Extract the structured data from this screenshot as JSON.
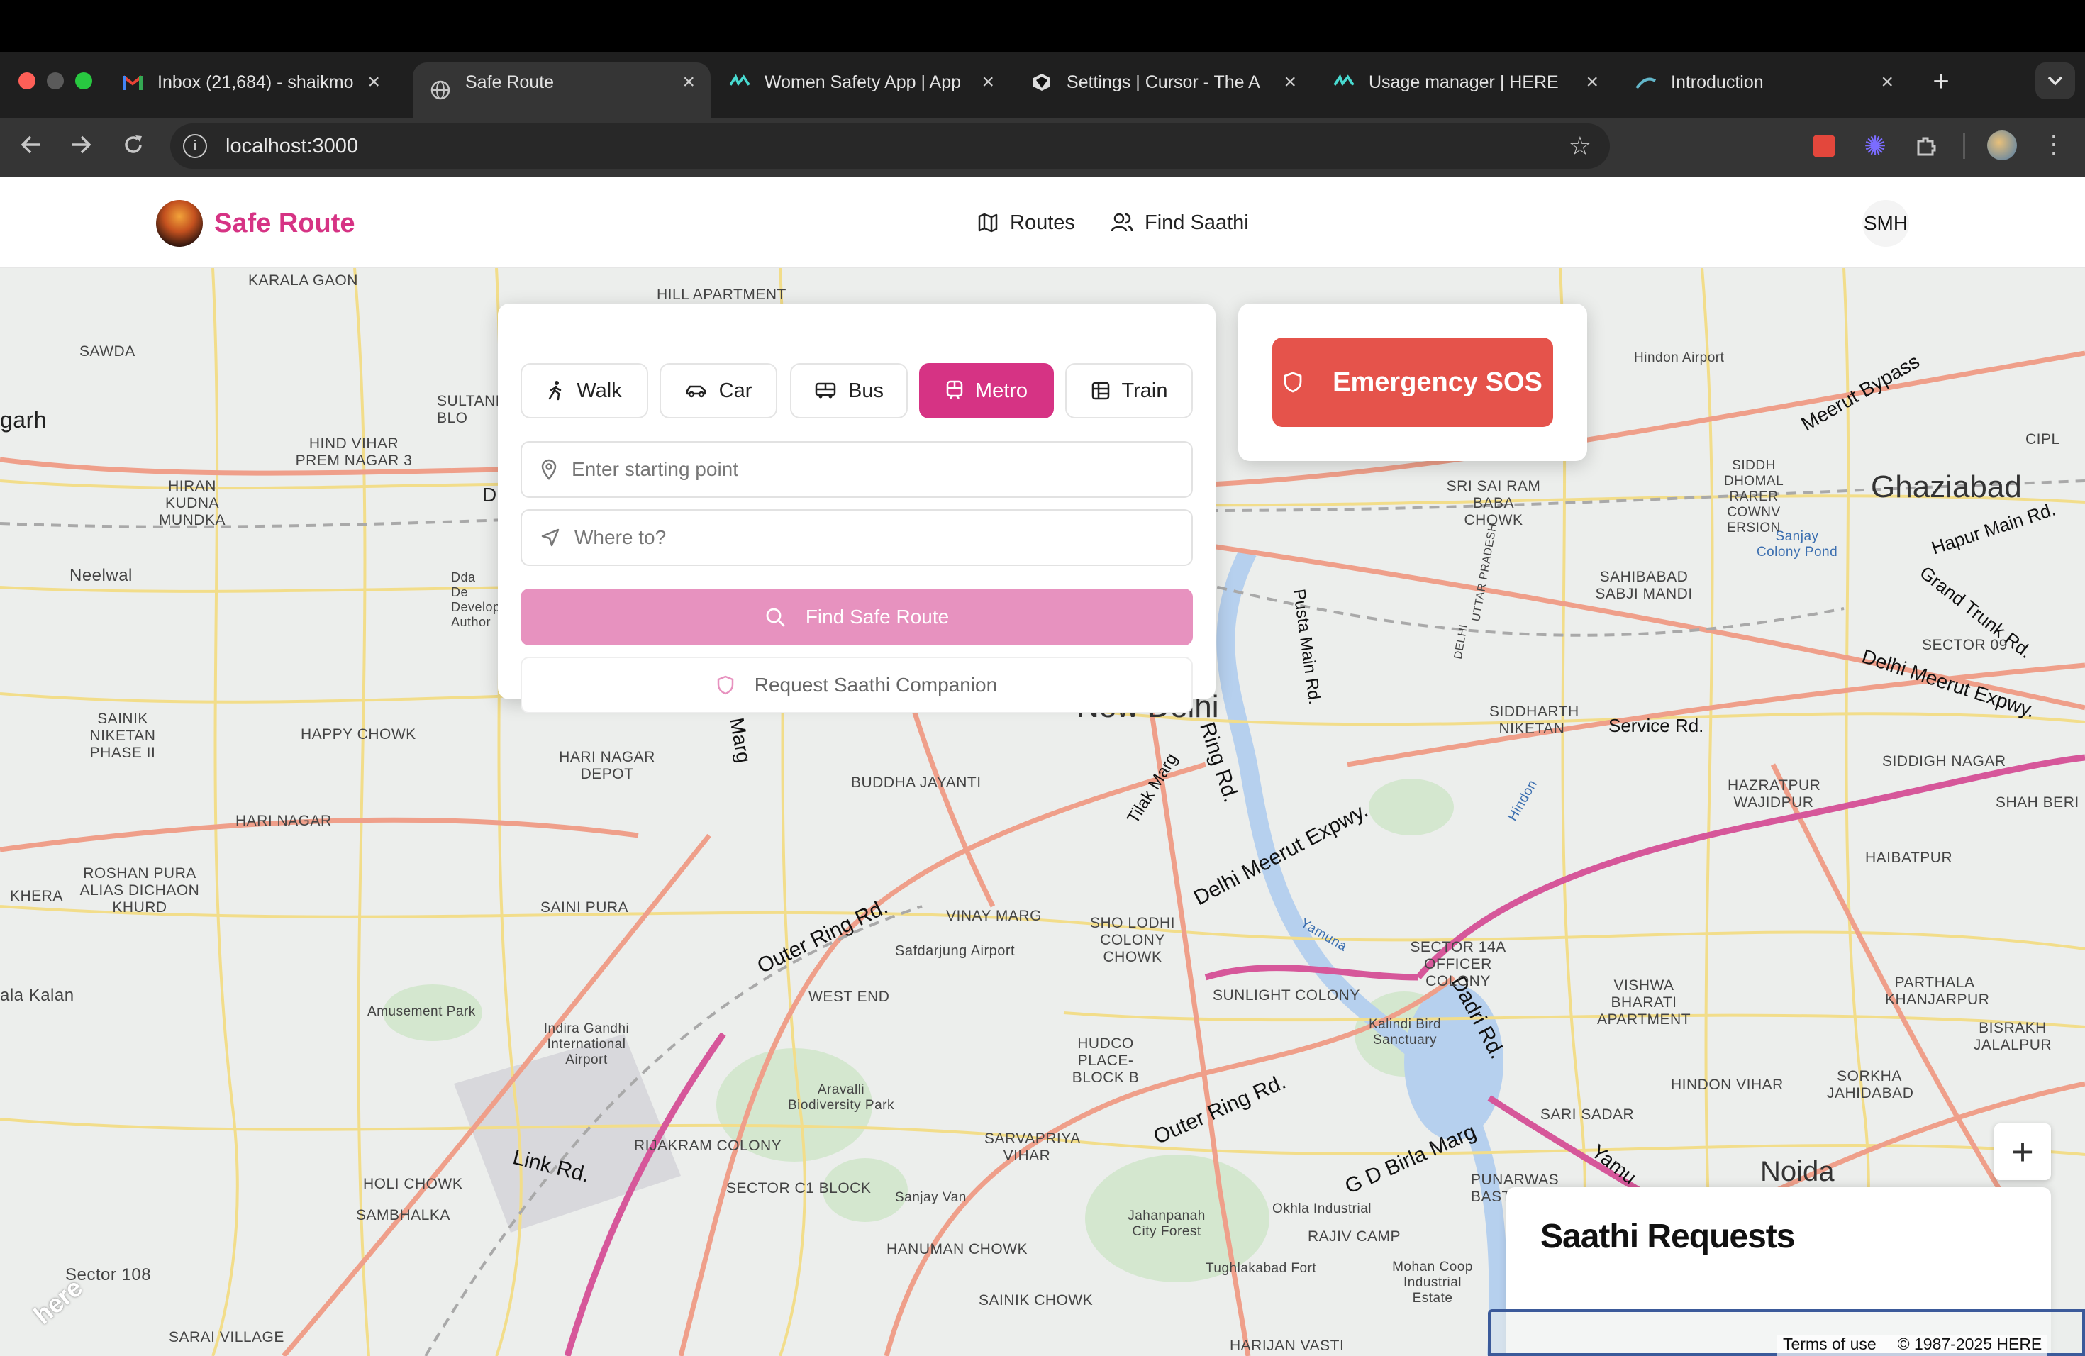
{
  "browser": {
    "tabs": [
      {
        "title": "Inbox (21,684) - shaikmo",
        "icon": "gmail-icon",
        "active": false
      },
      {
        "title": "Safe Route",
        "icon": "globe-icon",
        "active": true
      },
      {
        "title": "Women Safety App | App",
        "icon": "here-icon",
        "active": false
      },
      {
        "title": "Settings | Cursor - The A",
        "icon": "cursor-icon",
        "active": false
      },
      {
        "title": "Usage manager | HERE",
        "icon": "here-icon",
        "active": false
      },
      {
        "title": "Introduction",
        "icon": "docs-icon",
        "active": false
      }
    ],
    "url": "localhost:3000",
    "new_tab_label": "+",
    "close_label": "×"
  },
  "app": {
    "brand": "Safe Route",
    "brand_color": "#d63384",
    "nav": [
      {
        "label": "Routes",
        "icon": "map-icon"
      },
      {
        "label": "Find Saathi",
        "icon": "users-icon"
      }
    ],
    "user_initials": "SMH"
  },
  "route_panel": {
    "modes": [
      {
        "label": "Walk",
        "icon": "walk-icon",
        "selected": false
      },
      {
        "label": "Car",
        "icon": "car-icon",
        "selected": false
      },
      {
        "label": "Bus",
        "icon": "bus-icon",
        "selected": false
      },
      {
        "label": "Metro",
        "icon": "metro-icon",
        "selected": true
      },
      {
        "label": "Train",
        "icon": "train-icon",
        "selected": false
      }
    ],
    "start_placeholder": "Enter starting point",
    "destination_placeholder": "Where to?",
    "find_button": "Find Safe Route",
    "companion_button": "Request Saathi Companion"
  },
  "sos": {
    "label": "Emergency SOS",
    "color": "#e5534b"
  },
  "saathi_panel": {
    "title": "Saathi Requests"
  },
  "map": {
    "zoom_in_label": "+",
    "terms": "Terms of use",
    "copyright": "© 1987-2025 HERE",
    "watermark": "here",
    "cities": [
      "New Delhi",
      "Ghaziabad",
      "Noida"
    ],
    "roads": [
      "Outer Ring Rd.",
      "Delhi Meerut Expwy.",
      "Ring Rd.",
      "Outer Ring Rd.",
      "Link Rd.",
      "Dadri Rd.",
      "G D Birla Marg",
      "Tilak Marg",
      "Meerut Bypass",
      "Hapur Main Rd.",
      "Grand Trunk Rd.",
      "Delhi Meerut Expwy.",
      "Service Rd.",
      "Pusta Main Rd.",
      "ndhi Marg",
      "Yamu"
    ],
    "places": [
      "KARALA GAON",
      "SAWDA",
      "HILL APARTMENT",
      "HIND VIHAR PREM NAGAR 3",
      "HIRAN KUDNA MUNDKA",
      "Neelwal",
      "SULTANP BLO",
      "Dda De Develop Author",
      "SAINIK NIKETAN PHASE II",
      "HAPPY CHOWK",
      "HARI NAGAR DEPOT",
      "BUDDHA JAYANTI",
      "HARI NAGAR",
      "ROSHAN PURA ALIAS DICHAON KHURD",
      "KHERA",
      "SAINI PURA",
      "VINAY MARG",
      "SHO LODHI COLONY CHOWK",
      "Safdarjung Airport",
      "WEST END",
      "SUNLIGHT COLONY",
      "Amusement Park",
      "Indira Gandhi International Airport",
      "HUDCO PLACE-BLOCK B",
      "Aravalli Biodiversity Park",
      "RIJAKRAM COLONY",
      "SARVAPRIYA VIHAR",
      "SECTOR C1 BLOCK",
      "HOLI CHOWK",
      "SAMBHALKA",
      "Sanjay Van",
      "HANUMAN CHOWK",
      "Sector 108",
      "SARAI VILLAGE",
      "SAINIK CHOWK",
      "HARIJAN VASTI",
      "Tughlakabad Fort",
      "Jahanpanah City Forest",
      "Okhla Industrial",
      "RAJIV CAMP",
      "Mohan Coop Industrial Estate",
      "PUNARWAS BASTI PHASE III",
      "SARI SADAR",
      "Kalindi Bird Sanctuary",
      "SECTOR 14A OFFICER COLONY",
      "VISHWA BHARATI APARTMENT",
      "HINDON VIHAR",
      "SORKHA JAHIDABAD",
      "BISRAKH JALALPUR",
      "PARTHALA KHANJARPUR",
      "HAIBATPUR",
      "SHAH BERI",
      "SIDDIGH NAGAR",
      "HAZRATPUR WAJIDPUR",
      "SIDDHARTH NIKETAN",
      "SAHIBABAD SABJI MANDI",
      "SRI SAI RAM BABA CHOWK",
      "SIDDH DHOMAL RARER COWNV ERSION",
      "Sanjay Colony Pond",
      "Hindon Airport",
      "SECTOR 09",
      "CIPL",
      "ala Kalan",
      "garh",
      "UTTAR PRADESH",
      "DELHI",
      "Hindon",
      "Yamuna",
      "D"
    ]
  }
}
